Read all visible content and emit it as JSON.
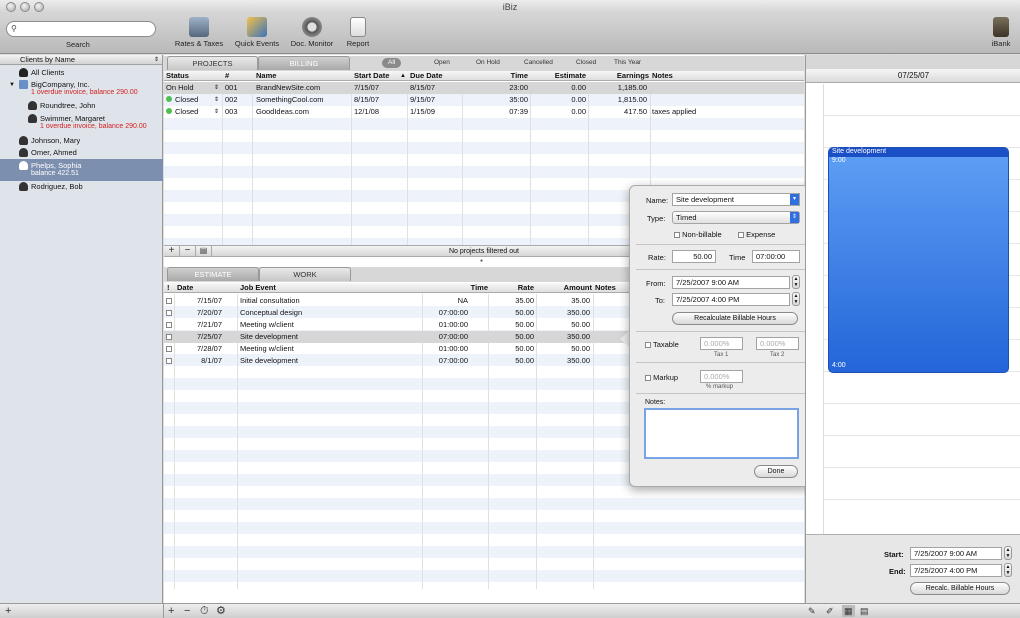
{
  "window": {
    "title": "iBiz"
  },
  "toolbar": {
    "search_placeholder": "",
    "search_label": "Search",
    "buttons": [
      {
        "label": "Rates & Taxes",
        "icon": "rates-taxes-icon"
      },
      {
        "label": "Quick Events",
        "icon": "quick-events-icon"
      },
      {
        "label": "Doc. Monitor",
        "icon": "doc-monitor-icon"
      },
      {
        "label": "Report",
        "icon": "report-icon"
      }
    ],
    "right_button": {
      "label": "iBank",
      "icon": "ibank-icon"
    }
  },
  "sidebar": {
    "header": "Clients by Name",
    "clients": [
      {
        "name": "All Clients",
        "sub": ""
      },
      {
        "name": "BigCompany, Inc.",
        "sub": "1 overdue invoice, balance 290.00"
      },
      {
        "name": "Roundtree, John",
        "sub": ""
      },
      {
        "name": "Swimmer, Margaret",
        "sub": "1 overdue invoice, balance 290.00"
      },
      {
        "name": "Johnson, Mary",
        "sub": ""
      },
      {
        "name": "Omer, Ahmed",
        "sub": ""
      },
      {
        "name": "Phelps, Sophia",
        "sub": "balance 422.51"
      },
      {
        "name": "Rodriguez, Bob",
        "sub": ""
      }
    ]
  },
  "projects": {
    "tabs": [
      "PROJECTS",
      "BILLING"
    ],
    "filters": [
      "All",
      "Open",
      "On Hold",
      "Cancelled",
      "Closed",
      "This Year"
    ],
    "columns": [
      "Status",
      "#",
      "Name",
      "Start Date",
      "Due Date",
      "Time",
      "Estimate",
      "Earnings",
      "Notes"
    ],
    "rows": [
      {
        "status": "On Hold",
        "num": "001",
        "name": "BrandNewSite.com",
        "start": "7/15/07",
        "due": "8/15/07",
        "time": "23:00",
        "estimate": "0.00",
        "earnings": "1,185.00",
        "notes": ""
      },
      {
        "status": "Closed",
        "num": "002",
        "name": "SomethingCool.com",
        "start": "8/15/07",
        "due": "9/15/07",
        "time": "35:00",
        "estimate": "0.00",
        "earnings": "1,815.00",
        "notes": ""
      },
      {
        "status": "Closed",
        "num": "003",
        "name": "GoodIdeas.com",
        "start": "12/1/08",
        "due": "1/15/09",
        "time": "07:39",
        "estimate": "0.00",
        "earnings": "417.50",
        "notes": "taxes applied"
      }
    ],
    "filter_status": "No projects filtered out"
  },
  "events": {
    "tabs": [
      "ESTIMATE",
      "WORK"
    ],
    "columns": [
      "!",
      "Date",
      "Job Event",
      "Time",
      "Rate",
      "Amount",
      "Notes"
    ],
    "rows": [
      {
        "date": "7/15/07",
        "event": "Initial consultation",
        "time": "NA",
        "rate": "35.00",
        "amount": "35.00"
      },
      {
        "date": "7/20/07",
        "event": "Conceptual design",
        "time": "07:00:00",
        "rate": "50.00",
        "amount": "350.00"
      },
      {
        "date": "7/21/07",
        "event": "Meeting w/client",
        "time": "01:00:00",
        "rate": "50.00",
        "amount": "50.00"
      },
      {
        "date": "7/25/07",
        "event": "Site development",
        "time": "07:00:00",
        "rate": "50.00",
        "amount": "350.00"
      },
      {
        "date": "7/28/07",
        "event": "Meeting w/client",
        "time": "01:00:00",
        "rate": "50.00",
        "amount": "50.00"
      },
      {
        "date": "8/1/07",
        "event": "Site development",
        "time": "07:00:00",
        "rate": "50.00",
        "amount": "350.00"
      }
    ]
  },
  "popover": {
    "name_label": "Name:",
    "name_value": "Site development",
    "type_label": "Type:",
    "type_value": "Timed",
    "nonbillable_label": "Non-billable",
    "expense_label": "Expense",
    "rate_label": "Rate:",
    "rate_value": "50.00",
    "time_label": "Time",
    "time_value": "07:00:00",
    "from_label": "From:",
    "from_value": "7/25/2007  9:00 AM",
    "to_label": "To:",
    "to_value": "7/25/2007  4:00 PM",
    "recalc_label": "Recalculate Billable Hours",
    "taxable_label": "Taxable",
    "tax1_value": "0.000%",
    "tax2_value": "0.000%",
    "tax1_label": "Tax 1",
    "tax2_label": "Tax 2",
    "markup_label": "Markup",
    "markup_value": "0.000%",
    "markup_caption": "% markup",
    "notes_label": "Notes:",
    "done_label": "Done"
  },
  "calendar": {
    "date": "07/25/07",
    "event_title": "Site development",
    "event_start": "9:00",
    "event_end": "4:00",
    "start_label": "Start:",
    "start_value": "7/25/2007  9:00 AM",
    "end_label": "End:",
    "end_value": "7/25/2007  4:00 PM",
    "recalc_label": "Recalc. Billable Hours"
  },
  "colors": {
    "selection": "#7d8fae",
    "event_blue": "#2f6fe0",
    "overdue_red": "#d42020"
  }
}
